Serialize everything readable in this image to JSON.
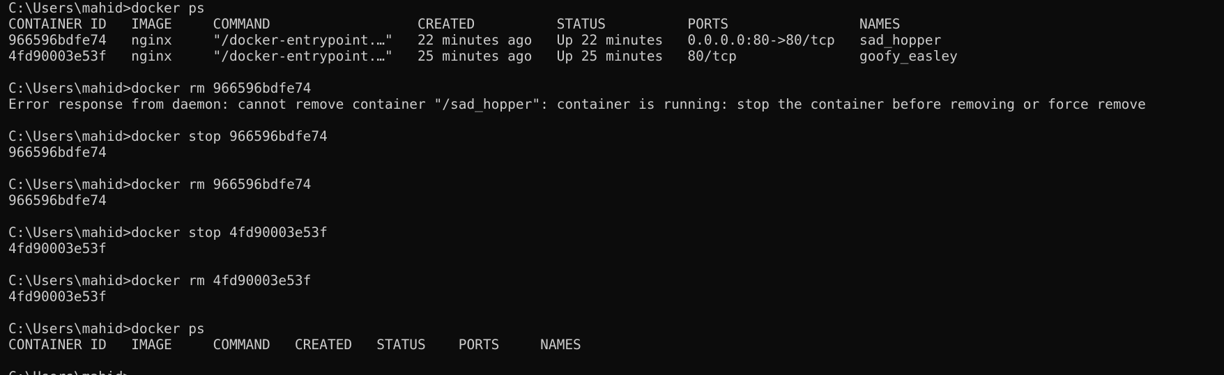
{
  "terminal": {
    "background_color": "#0c0c0c",
    "text_color": "#cccccc",
    "lines": [
      "C:\\Users\\mahid>docker ps",
      "CONTAINER ID   IMAGE     COMMAND                  CREATED          STATUS          PORTS                NAMES",
      "966596bdfe74   nginx     \"/docker-entrypoint.…\"   22 minutes ago   Up 22 minutes   0.0.0.0:80->80/tcp   sad_hopper",
      "4fd90003e53f   nginx     \"/docker-entrypoint.…\"   25 minutes ago   Up 25 minutes   80/tcp               goofy_easley",
      "",
      "C:\\Users\\mahid>docker rm 966596bdfe74",
      "Error response from daemon: cannot remove container \"/sad_hopper\": container is running: stop the container before removing or force remove",
      "",
      "C:\\Users\\mahid>docker stop 966596bdfe74",
      "966596bdfe74",
      "",
      "C:\\Users\\mahid>docker rm 966596bdfe74",
      "966596bdfe74",
      "",
      "C:\\Users\\mahid>docker stop 4fd90003e53f",
      "4fd90003e53f",
      "",
      "C:\\Users\\mahid>docker rm 4fd90003e53f",
      "4fd90003e53f",
      "",
      "C:\\Users\\mahid>docker ps",
      "CONTAINER ID   IMAGE     COMMAND   CREATED   STATUS    PORTS     NAMES",
      ""
    ],
    "prompt": "C:\\Users\\mahid>"
  }
}
